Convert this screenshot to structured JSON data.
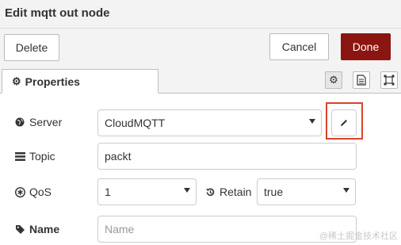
{
  "dialog": {
    "title": "Edit mqtt out node"
  },
  "toolbar": {
    "delete_label": "Delete",
    "cancel_label": "Cancel",
    "done_label": "Done"
  },
  "tabs": {
    "properties_label": "Properties",
    "icons": [
      "gear-icon",
      "document-icon",
      "frame-icon"
    ]
  },
  "form": {
    "server": {
      "label": "Server",
      "value": "CloudMQTT",
      "icon": "globe-icon"
    },
    "topic": {
      "label": "Topic",
      "value": "packt",
      "icon": "tasks-icon"
    },
    "qos": {
      "label": "QoS",
      "value": "1",
      "icon": "asterisk-circle-icon"
    },
    "retain": {
      "label": "Retain",
      "value": "true",
      "icon": "history-icon"
    },
    "name": {
      "label": "Name",
      "placeholder": "Name",
      "icon": "tag-icon"
    }
  },
  "edit_server": {
    "icon": "pencil-icon"
  },
  "watermark": {
    "text": "@稀土掘金技术社区"
  },
  "colors": {
    "done": "#8b1510",
    "highlight": "#d9432b",
    "header": "#f3f3f3"
  }
}
